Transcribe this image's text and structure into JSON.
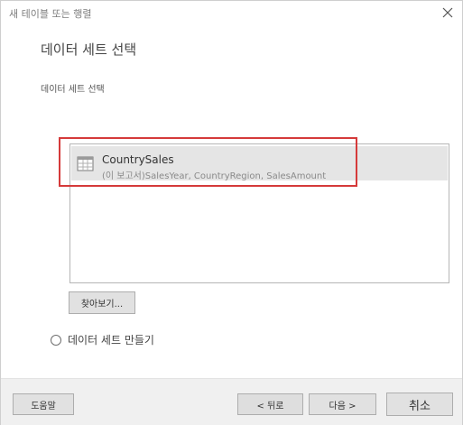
{
  "dialog": {
    "title": "새 테이블 또는 행렬",
    "heading": "데이터 세트 선택",
    "sublabel": "데이터 세트 선택"
  },
  "dataset_list": {
    "items": [
      {
        "name": "CountrySales",
        "detail": "(이 보고서)SalesYear, CountryRegion, SalesAmount",
        "icon": "table-icon",
        "selected": true
      }
    ]
  },
  "browse_label": "찾아보기...",
  "create_dataset_label": "데이터 세트 만들기",
  "footer": {
    "help_label": "도움말",
    "back_label": "< 뒤로",
    "next_label": "다음 >",
    "cancel_label": "취소"
  },
  "colors": {
    "highlight": "#d53a3a",
    "selected_row": "#e5e5e5",
    "footer_bg": "#f0f0f0"
  }
}
